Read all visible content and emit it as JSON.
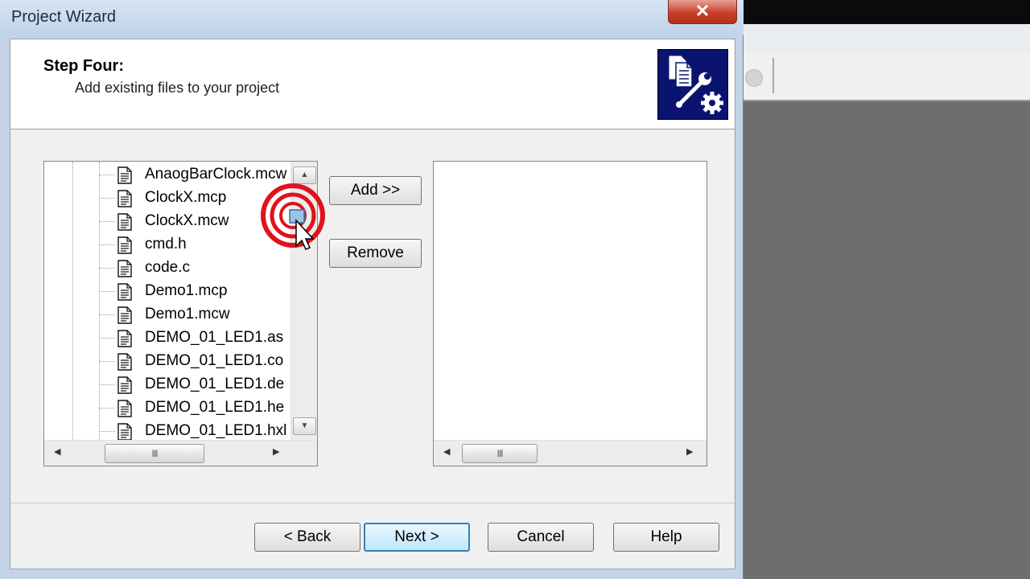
{
  "window": {
    "title": "Project Wizard",
    "close_glyph": "✕"
  },
  "header": {
    "step_title": "Step Four:",
    "step_subtitle": "Add existing files to your project",
    "icon": "files-wrench-gear-icon"
  },
  "file_list": {
    "items": [
      "AnaogBarClock.mcw",
      "ClockX.mcp",
      "ClockX.mcw",
      "cmd.h",
      "code.c",
      "Demo1.mcp",
      "Demo1.mcw",
      "DEMO_01_LED1.as",
      "DEMO_01_LED1.co",
      "DEMO_01_LED1.de",
      "DEMO_01_LED1.he",
      "DEMO_01_LED1.hxl"
    ],
    "scroll_thumb_grip": "III"
  },
  "middle_buttons": {
    "add": "Add >>",
    "remove": "Remove"
  },
  "selected_list": {
    "items": [],
    "scroll_thumb_grip": "III"
  },
  "footer": {
    "back": "< Back",
    "next": "Next >",
    "cancel": "Cancel",
    "help": "Help"
  },
  "colors": {
    "icon_bg": "#0a1470",
    "click_indicator": "#e0121b",
    "default_button_border": "#3c7fb1"
  }
}
